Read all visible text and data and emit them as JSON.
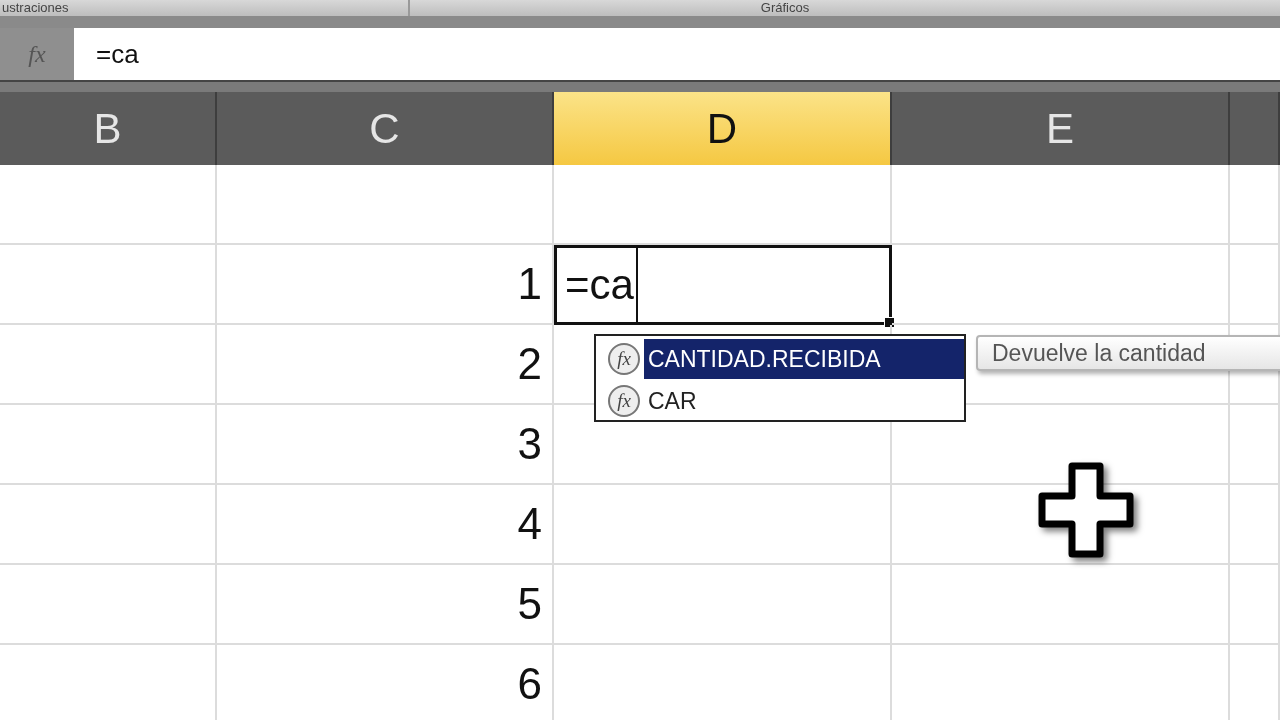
{
  "ribbon": {
    "groups": [
      "ustraciones",
      "Gráficos"
    ]
  },
  "formula_bar": {
    "icon": "fx",
    "value": "=ca"
  },
  "columns": [
    {
      "label": "B",
      "selected": false
    },
    {
      "label": "C",
      "selected": false
    },
    {
      "label": "D",
      "selected": true
    },
    {
      "label": "E",
      "selected": false
    }
  ],
  "rows": [
    {
      "label": "1",
      "active": true,
      "value": "=ca"
    },
    {
      "label": "2",
      "active": false
    },
    {
      "label": "3",
      "active": false
    },
    {
      "label": "4",
      "active": false
    },
    {
      "label": "5",
      "active": false
    },
    {
      "label": "6",
      "active": false
    }
  ],
  "autocomplete": {
    "items": [
      {
        "icon": "fx",
        "label": "CANTIDAD.RECIBIDA",
        "selected": true
      },
      {
        "icon": "fx",
        "label": "CAR",
        "selected": false
      }
    ]
  },
  "tooltip": {
    "text": "Devuelve la cantidad"
  }
}
